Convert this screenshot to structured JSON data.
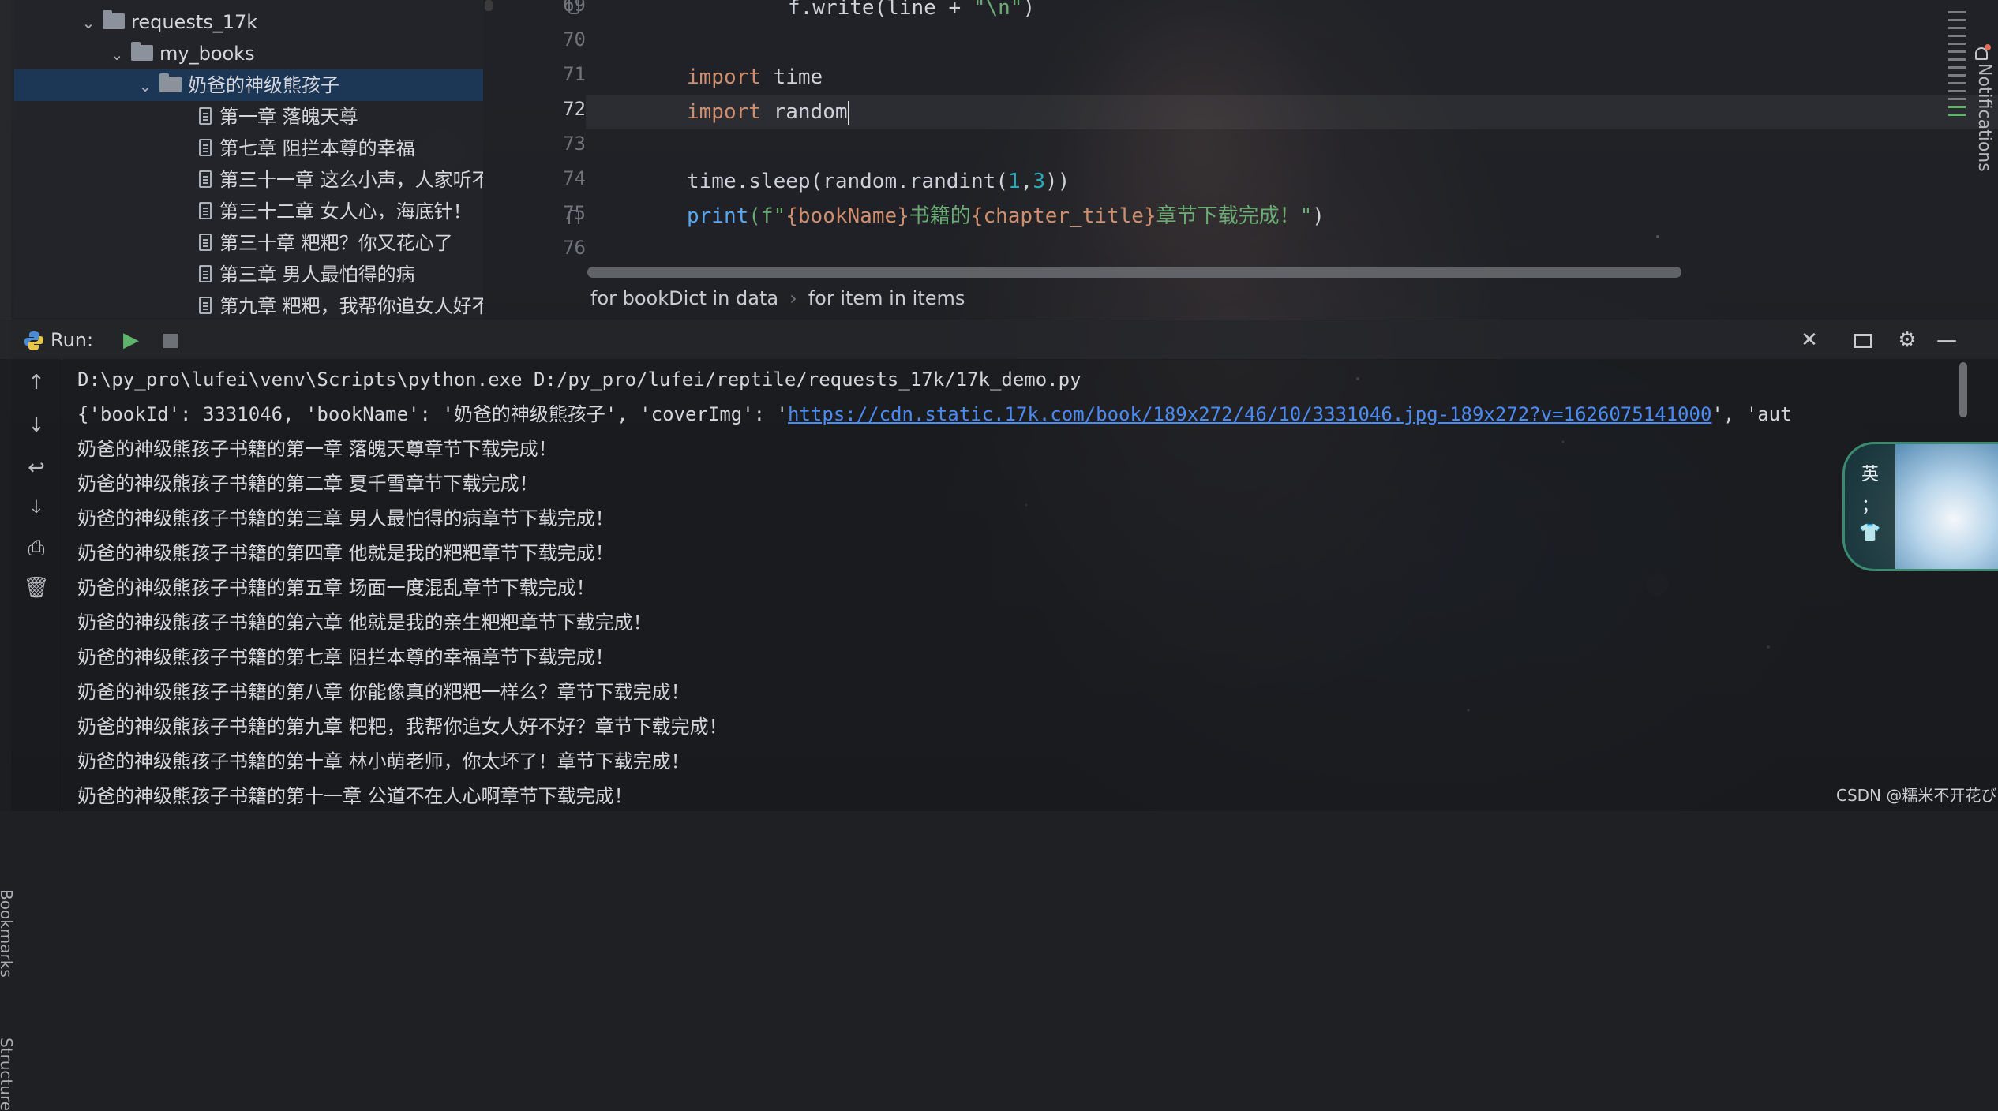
{
  "project_tree": {
    "items": [
      {
        "label": "requests_17k",
        "type": "folder"
      },
      {
        "label": "my_books",
        "type": "folder"
      },
      {
        "label": "奶爸的神级熊孩子",
        "type": "folder"
      },
      {
        "label": "第一章 落魄天尊",
        "type": "file"
      },
      {
        "label": "第七章 阻拦本尊的幸福",
        "type": "file"
      },
      {
        "label": "第三十一章 这么小声，人家听不",
        "type": "file"
      },
      {
        "label": "第三十二章 女人心，海底针！",
        "type": "file"
      },
      {
        "label": "第三十章 粑粑？你又花心了",
        "type": "file"
      },
      {
        "label": "第三章 男人最怕得的病",
        "type": "file"
      },
      {
        "label": "第九章 粑粑，我帮你追女人好不",
        "type": "file"
      }
    ]
  },
  "editor": {
    "line_numbers": [
      "69",
      "70",
      "71",
      "72",
      "73",
      "74",
      "75",
      "76"
    ],
    "line69": {
      "code": "f.write(line + ",
      "str": "\"\\n\"",
      "end": ")"
    },
    "line71": {
      "kw": "import",
      "rest": " time"
    },
    "line72": {
      "kw": "import",
      "rest": " random"
    },
    "line74": {
      "a": "time.sleep(random.randint(",
      "n1": "1",
      "comma": ",",
      "n2": "3",
      "end": "))"
    },
    "line75": {
      "fn": "print",
      "p1": "(f\"",
      "b1": "{bookName}",
      "t1": "书籍的",
      "b2": "{chapter_title}",
      "t2": "章节下载完成！\"",
      "end": ")"
    },
    "breadcrumb": [
      "for bookDict in data",
      "for item in items"
    ]
  },
  "notifications_label": "Notifications",
  "run": {
    "title": "Run:",
    "icons": [
      "run-icon",
      "stop-icon",
      "close-icon",
      "layout-icon",
      "gear-icon",
      "minimize-icon"
    ]
  },
  "console": {
    "line1": "D:\\py_pro\\lufei\\venv\\Scripts\\python.exe D:/py_pro/lufei/reptile/requests_17k/17k_demo.py",
    "line2_prefix": "{'bookId': 3331046, 'bookName': '奶爸的神级熊孩子', 'coverImg': '",
    "line2_link": "https://cdn.static.17k.com/book/189x272/46/10/3331046.jpg-189x272?v=1626075141000",
    "line2_suffix": "', 'aut",
    "lines": [
      "奶爸的神级熊孩子书籍的第一章 落魄天尊章节下载完成！",
      "奶爸的神级熊孩子书籍的第二章 夏千雪章节下载完成！",
      "奶爸的神级熊孩子书籍的第三章 男人最怕得的病章节下载完成！",
      "奶爸的神级熊孩子书籍的第四章 他就是我的粑粑章节下载完成！",
      "奶爸的神级熊孩子书籍的第五章 场面一度混乱章节下载完成！",
      "奶爸的神级熊孩子书籍的第六章 他就是我的亲生粑粑章节下载完成！",
      "奶爸的神级熊孩子书籍的第七章 阻拦本尊的幸福章节下载完成！",
      "奶爸的神级熊孩子书籍的第八章 你能像真的粑粑一样么？章节下载完成！",
      "奶爸的神级熊孩子书籍的第九章 粑粑，我帮你追女人好不好？章节下载完成！",
      "奶爸的神级熊孩子书籍的第十章 林小萌老师，你太坏了！章节下载完成！",
      "奶爸的神级熊孩子书籍的第十一章 公道不在人心啊章节下载完成！"
    ]
  },
  "side_labels": {
    "bookmarks": "Bookmarks",
    "structure": "Structure"
  },
  "ime": {
    "items": [
      "英",
      "；",
      "👕"
    ]
  },
  "watermark": "CSDN @糯米不开花び",
  "colors": {
    "keyword": "#cf8e6d",
    "string": "#6aab73",
    "number": "#2aacb8",
    "link": "#4b8bf4",
    "selection": "#1c3656"
  }
}
